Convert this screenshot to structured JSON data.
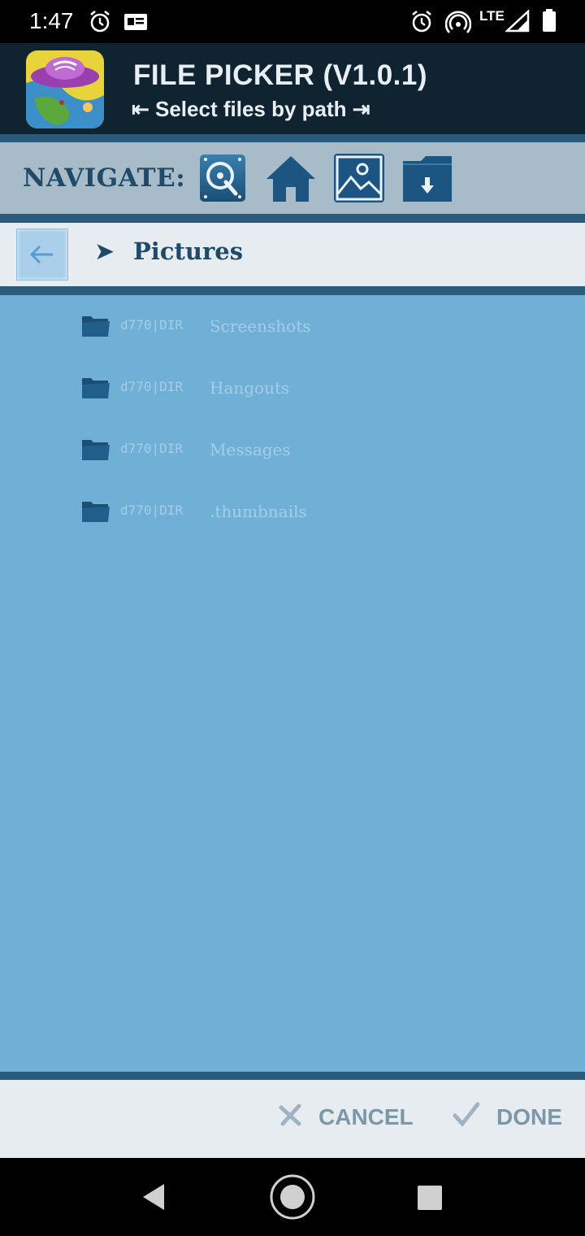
{
  "status": {
    "time": "1:47",
    "network": "LTE"
  },
  "header": {
    "title": "FILE PICKER (V1.0.1)",
    "subtitle": "⇤ Select files by path ⇥"
  },
  "navigate": {
    "label": "NAVIGATE:",
    "buttons": [
      "storage-icon",
      "home-icon",
      "pictures-icon",
      "downloads-icon"
    ]
  },
  "path": {
    "arrow": "➤",
    "current": "Pictures"
  },
  "files": [
    {
      "meta": "d770|DIR",
      "name": "Screenshots"
    },
    {
      "meta": "d770|DIR",
      "name": "Hangouts"
    },
    {
      "meta": "d770|DIR",
      "name": "Messages"
    },
    {
      "meta": "d770|DIR",
      "name": ".thumbnails"
    }
  ],
  "actions": {
    "cancel": "CANCEL",
    "done": "DONE"
  },
  "colors": {
    "header_bg": "#0f2330",
    "list_bg": "#70afd6",
    "accent": "#1f4a6a"
  }
}
